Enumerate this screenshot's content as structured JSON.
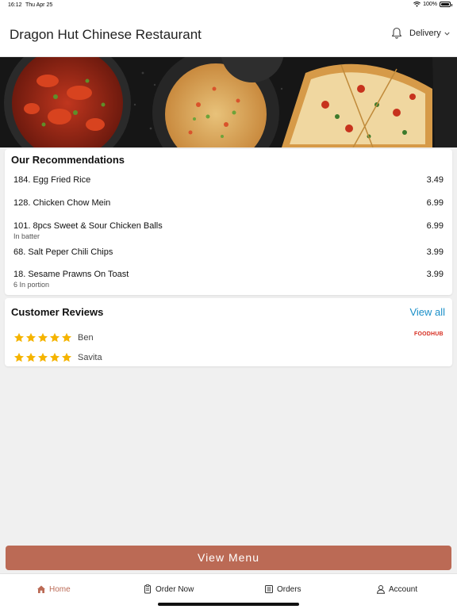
{
  "status_bar": {
    "time": "16:12",
    "date": "Thu Apr 25",
    "battery": "100%",
    "battery_level": 1.0
  },
  "header": {
    "restaurant_name": "Dragon Hut Chinese Restaurant",
    "delivery_label": "Delivery"
  },
  "recommendations": {
    "title": "Our Recommendations",
    "items": [
      {
        "name": "184. Egg Fried Rice",
        "price": "3.49",
        "description": ""
      },
      {
        "name": "128. Chicken Chow Mein",
        "price": "6.99",
        "description": ""
      },
      {
        "name": "101. 8pcs Sweet & Sour Chicken Balls",
        "price": "6.99",
        "description": "In batter"
      },
      {
        "name": "68. Salt Peper Chili Chips",
        "price": "3.99",
        "description": ""
      },
      {
        "name": "18. Sesame Prawns On Toast",
        "price": "3.99",
        "description": "6 In portion"
      }
    ]
  },
  "reviews": {
    "title": "Customer Reviews",
    "view_all": "View all",
    "source_logo": "FOODHUB",
    "items": [
      {
        "reviewer": "Ben",
        "stars": 5
      },
      {
        "reviewer": "Savita",
        "stars": 5
      }
    ]
  },
  "view_menu_label": "View Menu",
  "tabs": [
    {
      "label": "Home",
      "icon": "home-icon",
      "active": true
    },
    {
      "label": "Order Now",
      "icon": "order-now-icon",
      "active": false
    },
    {
      "label": "Orders",
      "icon": "orders-icon",
      "active": false
    },
    {
      "label": "Account",
      "icon": "account-icon",
      "active": false
    }
  ],
  "colors": {
    "accent": "#bb6a55",
    "link": "#1a8fc8",
    "star": "#f5b400",
    "brand_logo": "#d62d20"
  }
}
